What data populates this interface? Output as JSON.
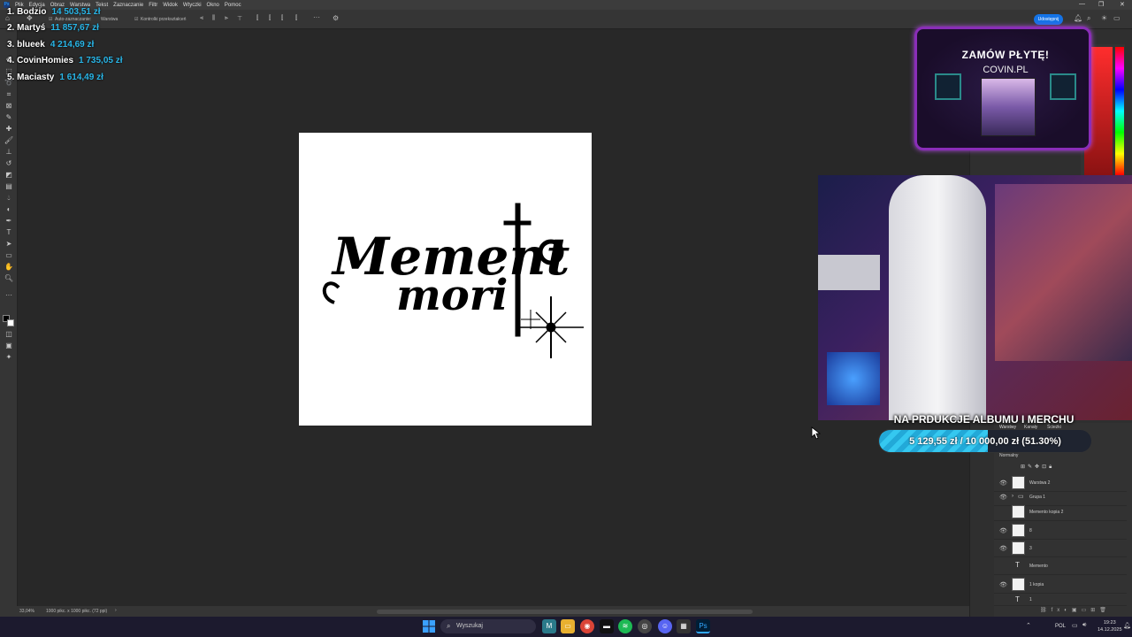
{
  "menu": {
    "items": [
      "Plik",
      "Edycja",
      "Obraz",
      "Warstwa",
      "Tekst",
      "Zaznaczanie",
      "Filtr",
      "Widok",
      "Wtyczki",
      "Okno",
      "Pomoc"
    ]
  },
  "options_bar": {
    "auto_select_label": "Auto-zaznaczanie:",
    "layer_select": "Warstwa",
    "transform_controls_label": "Kontrolki przekształceń",
    "share_label": "Udostępnij"
  },
  "leaderboard": [
    {
      "rank_name": "1. Bodzio",
      "amount": "14 503,51 zł"
    },
    {
      "rank_name": "2. Martyś",
      "amount": "11 857,67 zł"
    },
    {
      "rank_name": "3. blueek",
      "amount": "4 214,69 zł"
    },
    {
      "rank_name": "4. CovinHomies",
      "amount": "1 735,05 zł"
    },
    {
      "rank_name": "5. Maciasty",
      "amount": "1 614,49 zł"
    }
  ],
  "promo": {
    "title": "ZAMÓW PŁYTĘ!",
    "url": "COVIN.PL"
  },
  "goal": {
    "title": "NA PRDUKCJE ALBUMU I MERCHU",
    "progress_text": "5 129,55 zł / 10 000,00 zł (51.30%)",
    "progress_fraction": 0.513
  },
  "status_bar": {
    "zoom": "33,04%",
    "doc_info": "1000 pikс. x 1000 pikс. (72 ppi)"
  },
  "layers_panel": {
    "tabs": [
      "Warstwy",
      "Kanały",
      "Ścieżki"
    ],
    "blend_mode": "Normalny",
    "layers": [
      {
        "name": "Warstwa 2",
        "kind": "pixel",
        "visible": true
      },
      {
        "name": "Grupa 1",
        "kind": "group",
        "visible": true
      },
      {
        "name": "Memento kopia 2",
        "kind": "pixel",
        "visible": false
      },
      {
        "name": "8",
        "kind": "pixel",
        "visible": true
      },
      {
        "name": "3",
        "kind": "pixel",
        "visible": true
      },
      {
        "name": "Memento",
        "kind": "text",
        "visible": false
      },
      {
        "name": "1 kopia",
        "kind": "pixel",
        "visible": true
      },
      {
        "name": "1",
        "kind": "text",
        "visible": false
      }
    ]
  },
  "taskbar": {
    "search_placeholder": "Wyszukaj",
    "language": "POL",
    "time": "19:23",
    "date": "14.12.2025"
  },
  "colors": {
    "accent_blue": "#1473e6",
    "leaderboard_amount": "#29b6e8",
    "goal_fill": "#35c8f0",
    "promo_border": "#8a2db8"
  }
}
